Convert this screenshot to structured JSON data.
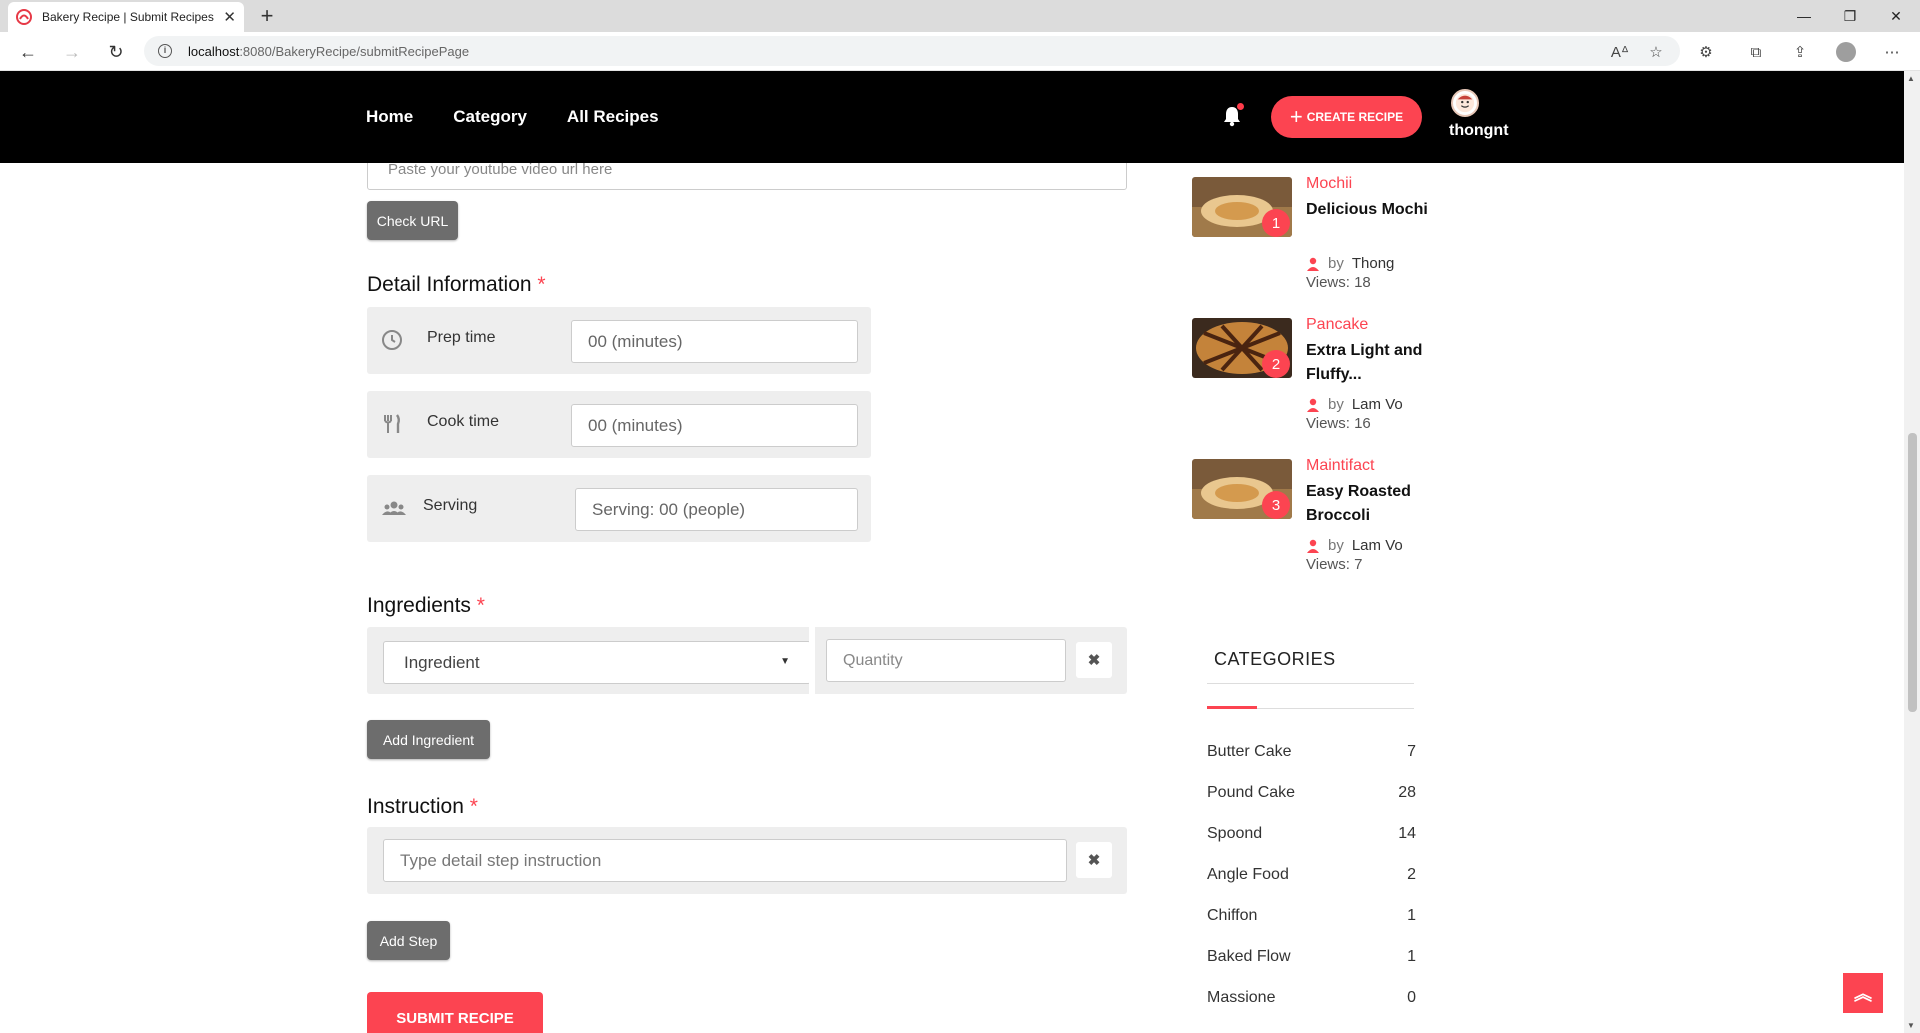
{
  "browser": {
    "tab_title": "Bakery Recipe | Submit Recipes",
    "url_host": "localhost",
    "url_path": ":8080/BakeryRecipe/submitRecipePage"
  },
  "header": {
    "nav": [
      "Home",
      "Category",
      "All Recipes"
    ],
    "create_label": "CREATE RECIPE",
    "username": "thongnt"
  },
  "form": {
    "youtube_placeholder": "Paste your youtube video url here",
    "check_url_label": "Check URL",
    "detail_title": "Detail Information",
    "prep_label": "Prep time",
    "prep_placeholder": "00 (minutes)",
    "cook_label": "Cook time",
    "cook_placeholder": "00 (minutes)",
    "serving_label": "Serving",
    "serving_placeholder": "Serving: 00 (people)",
    "ingredients_title": "Ingredients",
    "ingredient_select": "Ingredient",
    "quantity_placeholder": "Quantity",
    "add_ingredient_label": "Add Ingredient",
    "instruction_title": "Instruction",
    "instruction_placeholder": "Type detail step instruction",
    "add_step_label": "Add Step",
    "submit_label": "SUBMIT RECIPE",
    "required_mark": "*"
  },
  "popular": [
    {
      "rank": "1",
      "category": "Mochii",
      "title": "Delicious Mochi",
      "by": "by",
      "author": "Thong",
      "views": "Views: 18"
    },
    {
      "rank": "2",
      "category": "Pancake",
      "title": "Extra Light and Fluffy...",
      "by": "by",
      "author": "Lam Vo",
      "views": "Views: 16"
    },
    {
      "rank": "3",
      "category": "Maintifact",
      "title": "Easy Roasted Broccoli",
      "by": "by",
      "author": "Lam Vo",
      "views": "Views: 7"
    }
  ],
  "categories": {
    "heading": "CATEGORIES",
    "items": [
      {
        "name": "Butter Cake",
        "count": "7"
      },
      {
        "name": "Pound Cake",
        "count": "28"
      },
      {
        "name": "Spoond",
        "count": "14"
      },
      {
        "name": "Angle Food",
        "count": "2"
      },
      {
        "name": "Chiffon",
        "count": "1"
      },
      {
        "name": "Baked Flow",
        "count": "1"
      },
      {
        "name": "Massione",
        "count": "0"
      }
    ]
  },
  "colors": {
    "accent": "#fc4451",
    "header_bg": "#000000",
    "button_gray": "#6d6d6d"
  },
  "icons": [
    "back-icon",
    "forward-icon",
    "reload-icon",
    "bell-icon",
    "clock-icon",
    "utensils-icon",
    "users-icon",
    "user-icon",
    "arrow-up-icon"
  ]
}
